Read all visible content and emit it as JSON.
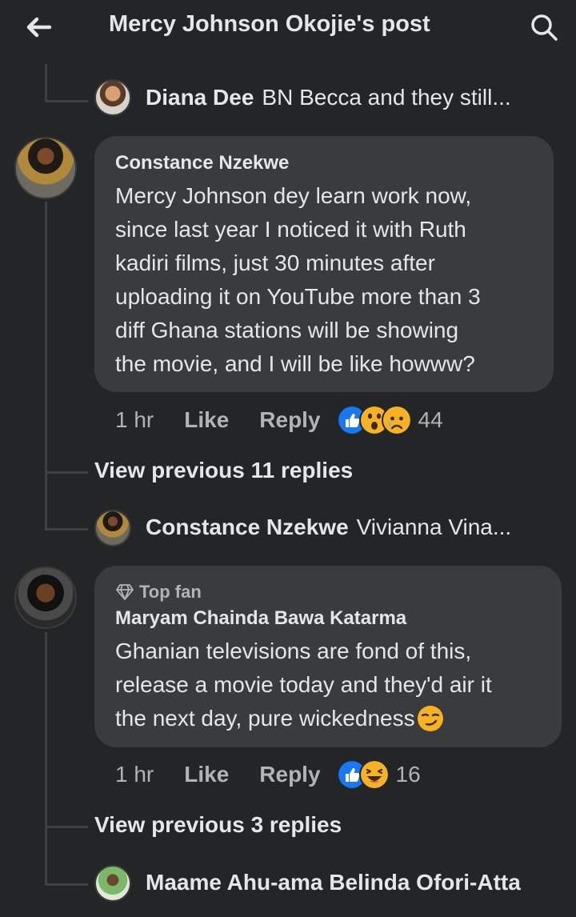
{
  "header": {
    "title": "Mercy Johnson Okojie's post",
    "back_icon": "arrow-left-icon",
    "search_icon": "search-icon"
  },
  "replies_top": {
    "name": "Diana Dee",
    "text": "BN Becca and they still..."
  },
  "comment1": {
    "author": "Constance Nzekwe",
    "text_lines": [
      "Mercy Johnson dey learn work now,",
      "since last year I noticed it with Ruth",
      "kadiri films, just 30 minutes after",
      "uploading it on YouTube more than 3",
      "diff Ghana stations will be showing",
      "the movie, and I will be like howww?"
    ],
    "time": "1 hr",
    "like": "Like",
    "reply": "Reply",
    "reaction_count": "44",
    "reactions": [
      "like-reaction",
      "wow-reaction",
      "sad-reaction"
    ],
    "view_previous": "View previous 11 replies",
    "last_reply": {
      "name": "Constance Nzekwe",
      "text": "Vivianna Vina..."
    }
  },
  "comment2": {
    "badge": "Top fan",
    "author": "Maryam Chainda Bawa Katarma",
    "text_lines": [
      "Ghanian televisions are fond of this,",
      "release a movie today and they'd air it",
      "the next day, pure wickedness"
    ],
    "emoji": "smirk-emoji",
    "time": "1 hr",
    "like": "Like",
    "reply": "Reply",
    "reaction_count": "16",
    "reactions": [
      "like-reaction",
      "haha-reaction"
    ],
    "view_previous": "View previous 3 replies",
    "last_reply": {
      "name": "Maame Ahu-ama Belinda Ofori-Atta",
      "text": ""
    }
  },
  "colors": {
    "background": "#242526",
    "bubble": "#3a3b3c",
    "primary_text": "#e4e6eb",
    "secondary_text": "#b0b3b8",
    "like_blue": "#1877f2",
    "emoji_yellow": "#f7b125"
  }
}
